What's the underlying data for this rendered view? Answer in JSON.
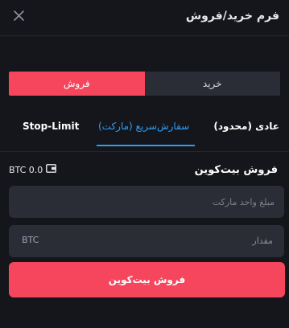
{
  "header": {
    "title": "فرم خرید/فروش",
    "close_icon": "close-icon"
  },
  "side_toggle": {
    "sell_label": "فروش",
    "buy_label": "خرید",
    "active": "sell"
  },
  "order_types": {
    "stop_limit": "Stop-Limit",
    "market": "سفارش‌سریع (مارکت)",
    "limit": "عادی (محدود)",
    "active": "market"
  },
  "balance": {
    "value": "BTC 0.0",
    "icon": "wallet-icon"
  },
  "section_title": "فروش بیت‌کوین",
  "amount_field": {
    "placeholder": "مبلغ واحد مارکت",
    "value": ""
  },
  "quantity_field": {
    "label": "مقدار",
    "unit": "BTC"
  },
  "submit_label": "فروش بیت‌کوین",
  "colors": {
    "background": "#15161b",
    "sell": "#f6465d",
    "accent": "#2f9cf4",
    "field": "#2a2c36"
  }
}
